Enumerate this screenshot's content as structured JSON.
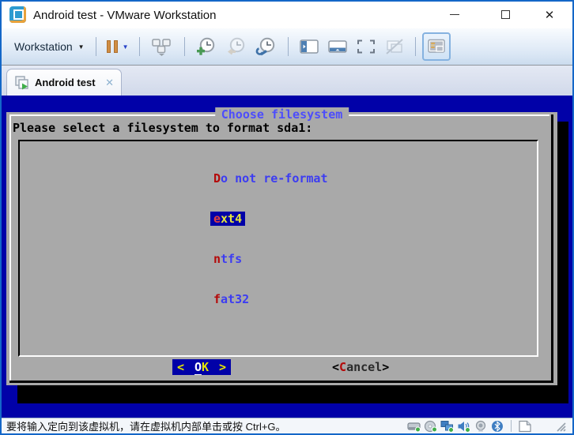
{
  "window": {
    "title": "Android test - VMware Workstation",
    "close_glyph": "✕"
  },
  "toolbar": {
    "workstation_label": "Workstation",
    "workstation_caret": "▼",
    "pause_caret": "▼",
    "icon_names": [
      "pause",
      "send-ctrl-alt-del",
      "take-snapshot",
      "revert-snapshot",
      "manage-snapshots",
      "show-library",
      "show-thumbnail-bar",
      "fullscreen",
      "unity-mode",
      "console-view"
    ]
  },
  "tab": {
    "label": "Android test",
    "close_glyph": "✕"
  },
  "vm_dialog": {
    "title": "Choose filesystem",
    "prompt": "Please select a filesystem to format sda1:",
    "items": [
      {
        "hotkey": "D",
        "rest": "o not re-format",
        "selected": false
      },
      {
        "hotkey": "e",
        "rest": "xt4",
        "selected": true
      },
      {
        "hotkey": "n",
        "rest": "tfs",
        "selected": false
      },
      {
        "hotkey": "f",
        "rest": "at32",
        "selected": false
      }
    ],
    "ok": {
      "open": "<",
      "hotkey": "O",
      "rest": "K",
      "close": ">"
    },
    "cancel": {
      "open": "<",
      "hotkey": "C",
      "rest": "ancel",
      "close": ">"
    }
  },
  "status_bar": {
    "message": "要将输入定向到该虚拟机，请在虚拟机内部单击或按 Ctrl+G。",
    "device_icon_names": [
      "hard-disk",
      "cd-rom",
      "network-adapter",
      "sound",
      "webcam",
      "bluetooth",
      "message-log"
    ]
  },
  "colors": {
    "vm_blue": "#0101a8",
    "dialog_gray": "#a9a9a9",
    "hotkey_red": "#b40a0a",
    "item_blue": "#3c3cf2",
    "selected_yellow": "#e6e63c",
    "title_blue": "#4d4dfc",
    "window_border": "#1467c8"
  }
}
